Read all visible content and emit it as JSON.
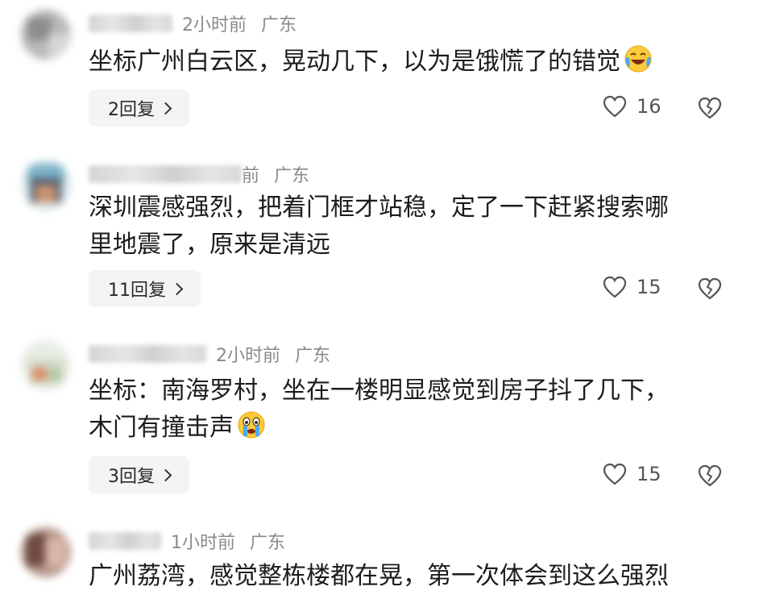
{
  "comments": [
    {
      "time": "2小时前",
      "location": "广东",
      "lines": [
        "坐标广州白云区，晃动几下，以为是饿慌了的错觉"
      ],
      "emoji": "laughing-crying-emoji",
      "reply_label": "2回复",
      "likes": "16"
    },
    {
      "time": "",
      "location": "广东",
      "time_fragment": "前",
      "lines": [
        "深圳震感强烈，把着门框才站稳，定了一下赶紧搜索哪",
        "里地震了，原来是清远"
      ],
      "emoji": null,
      "reply_label": "11回复",
      "likes": "15"
    },
    {
      "time": "2小时前",
      "location": "广东",
      "lines": [
        "坐标：南海罗村，坐在一楼明显感觉到房子抖了几下，",
        "木门有撞击声"
      ],
      "emoji": "crying-emoji",
      "reply_label": "3回复",
      "likes": "15"
    },
    {
      "time": "1小时前",
      "location": "广东",
      "lines": [
        "广州荔湾，感觉整栋楼都在晃，第一次体会到这么强烈"
      ],
      "emoji": null,
      "reply_label": null,
      "likes": null
    }
  ],
  "icons": {
    "like": "heart-outline-icon",
    "dislike": "broken-heart-icon",
    "reply_chevron": "chevron-right-icon"
  },
  "colors": {
    "text": "#1c1c1c",
    "meta": "#8a8a8a",
    "reply_bg": "#f4f4f4",
    "icon": "#555555"
  }
}
